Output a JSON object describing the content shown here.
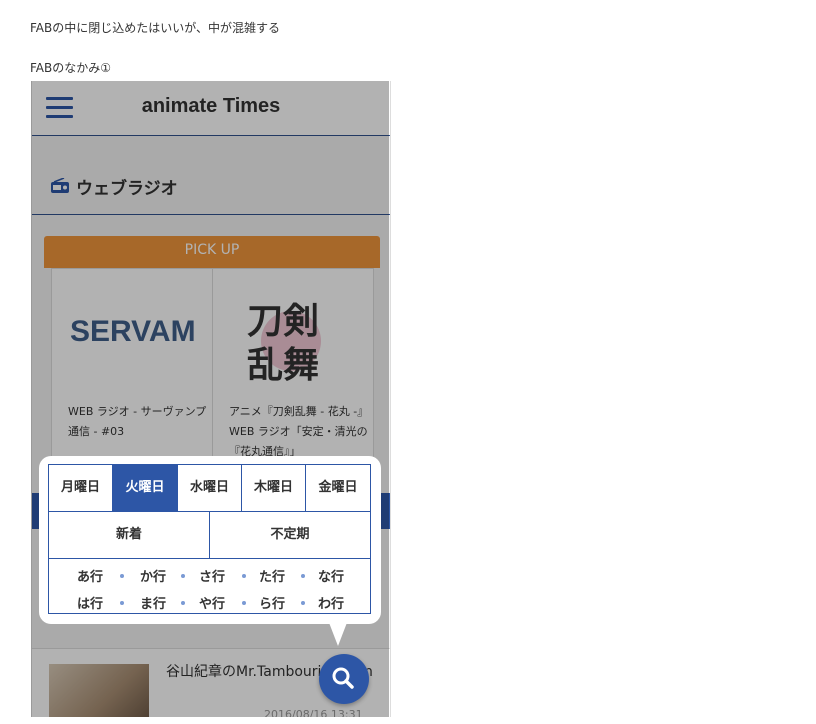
{
  "notes": {
    "line1": "FABの中に閉じ込めたはいいが、中が混雑する",
    "line2": "FABのなかみ①"
  },
  "header": {
    "logo": "animate Times"
  },
  "section": {
    "title": "ウェブラジオ",
    "icon": "radio-icon"
  },
  "pickup": {
    "label": "PICK UP"
  },
  "cards": [
    {
      "logo_text": "SERVAMP",
      "lines": [
        "WEB ラジオ - サーヴァンプ",
        "通信 - #03"
      ]
    },
    {
      "logo_text": "刀剣乱舞",
      "lines": [
        "アニメ『刀剣乱舞 - 花丸 -』",
        "WEB ラジオ「安定・清光の",
        "『花丸通信』」"
      ]
    }
  ],
  "list": {
    "date1": "2016/08/",
    "title": "谷山紀章のMr.Tambourine Man",
    "date2": "2016/08/16 13:31"
  },
  "fab_menu": {
    "days": [
      "月曜日",
      "火曜日",
      "水曜日",
      "木曜日",
      "金曜日"
    ],
    "active_day": "火曜日",
    "extra": [
      "新着",
      "不定期"
    ],
    "kana_row1": [
      "あ行",
      "か行",
      "さ行",
      "た行",
      "な行"
    ],
    "kana_row2": [
      "は行",
      "ま行",
      "や行",
      "ら行",
      "わ行"
    ]
  },
  "fab": {
    "icon": "search-icon"
  },
  "colors": {
    "accent": "#2d56a6",
    "pickup": "#f0963c"
  }
}
